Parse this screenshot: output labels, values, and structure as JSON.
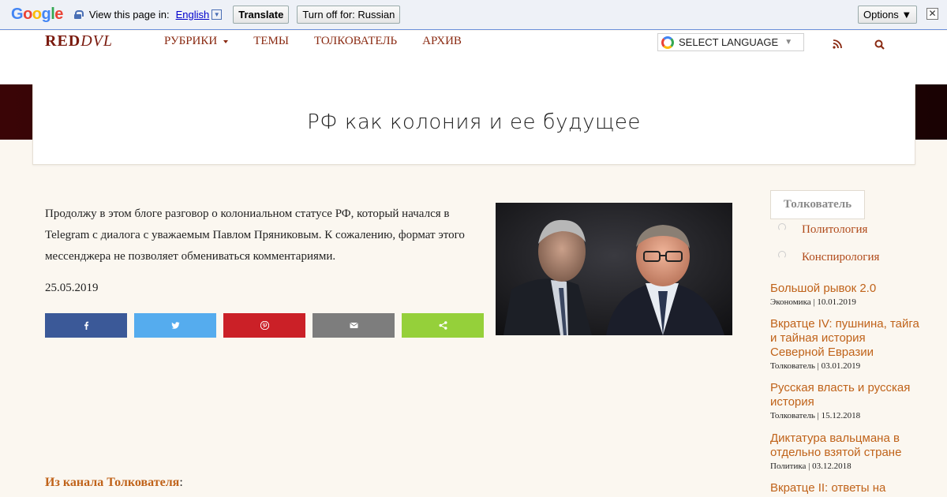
{
  "translate_bar": {
    "logo": "Google",
    "view_text": "View this page in:",
    "language": "English",
    "translate_label": "Translate",
    "turn_off_label": "Turn off for: Russian",
    "options_label": "Options ▼",
    "close_symbol": "✕"
  },
  "header": {
    "logo_red": "RED",
    "logo_dvl": "DVL",
    "nav": [
      {
        "label": "РУБРИКИ"
      },
      {
        "label": "ТЕМЫ"
      },
      {
        "label": "ТОЛКОВАТЕЛЬ"
      },
      {
        "label": "АРХИВ"
      }
    ],
    "select_language": "SELECT LANGUAGE",
    "select_arrow": "▼"
  },
  "article": {
    "title": "РФ как колония и ее будущее",
    "intro": "Продолжу в этом блоге разговор о колониальном статусе РФ, который начался в Telegram с диалога с уважаемым Павлом Пряниковым. К сожалению, формат этого мессенджера не позволяет обмениваться комментариями.",
    "date": "25.05.2019",
    "channel_prefix": "Из канала Толкователя",
    "channel_suffix": ":"
  },
  "share": [
    {
      "icon": "facebook-icon",
      "color": "#3b5998"
    },
    {
      "icon": "twitter-icon",
      "color": "#55acee"
    },
    {
      "icon": "pinterest-icon",
      "color": "#cb2027"
    },
    {
      "icon": "email-icon",
      "color": "#7d7d7d"
    },
    {
      "icon": "share-icon",
      "color": "#95d03a"
    }
  ],
  "sidebar": {
    "tab": "Толкователь",
    "categories": [
      {
        "label": "Политология"
      },
      {
        "label": "Конспирология"
      }
    ],
    "posts": [
      {
        "title": "Большой рывок 2.0",
        "meta": "Экономика | 10.01.2019"
      },
      {
        "title": "Вкратце IV: пушнина, тайга и тайная история Северной Евразии",
        "meta": "Толкователь | 03.01.2019"
      },
      {
        "title": "Русская власть и русская история",
        "meta": "Толкователь | 15.12.2018"
      },
      {
        "title": "Диктатура вальцмана в отдельно взятой стране",
        "meta": "Политика | 03.12.2018"
      },
      {
        "title": "Вкратце II: ответы на",
        "meta": ""
      }
    ]
  },
  "colors": {
    "accent": "#c0631a",
    "nav": "#8a2a12",
    "hero": "#3a0506"
  }
}
